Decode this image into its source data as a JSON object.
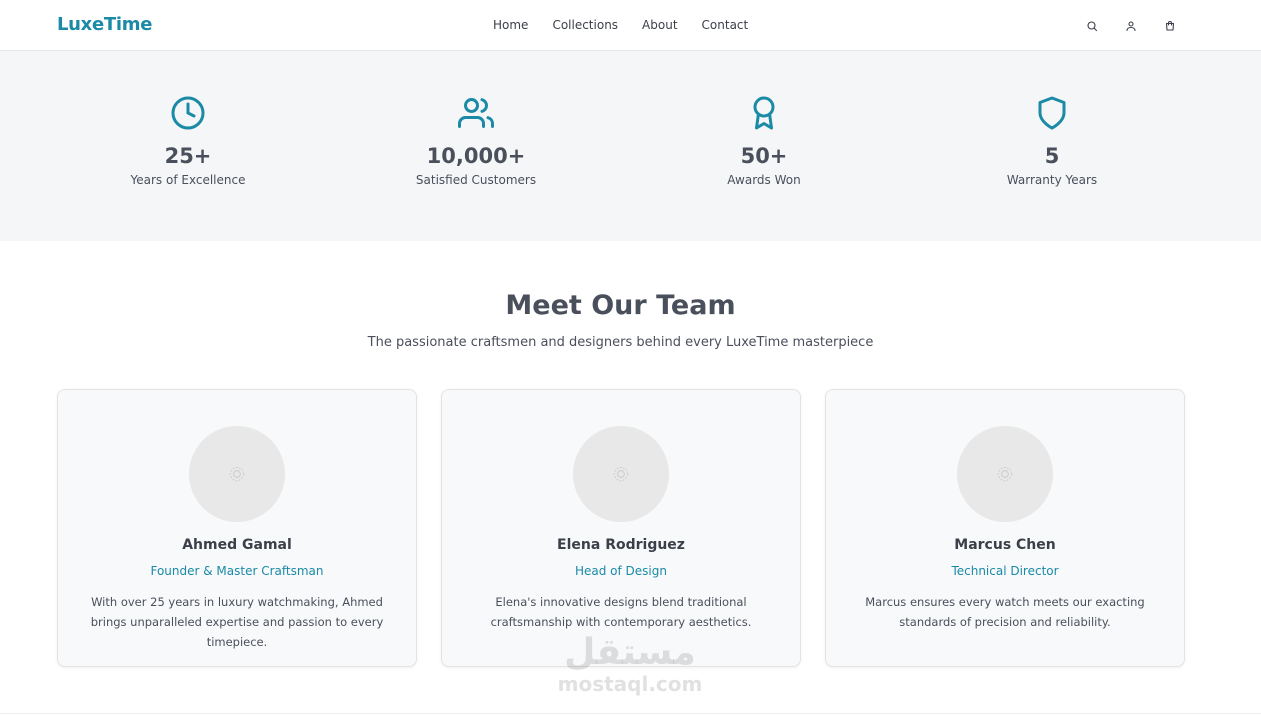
{
  "brand": {
    "name": "LuxeTime",
    "accent_color": "#1a8aa6"
  },
  "nav": {
    "items": [
      {
        "label": "Home"
      },
      {
        "label": "Collections"
      },
      {
        "label": "About"
      },
      {
        "label": "Contact"
      }
    ],
    "icons": [
      "search-icon",
      "user-icon",
      "cart-icon"
    ]
  },
  "stats": [
    {
      "icon": "clock-icon",
      "value": "25+",
      "label": "Years of Excellence"
    },
    {
      "icon": "users-icon",
      "value": "10,000+",
      "label": "Satisfied Customers"
    },
    {
      "icon": "award-icon",
      "value": "50+",
      "label": "Awards Won"
    },
    {
      "icon": "shield-icon",
      "value": "5",
      "label": "Warranty Years"
    }
  ],
  "team": {
    "title": "Meet Our Team",
    "subtitle": "The passionate craftsmen and designers behind every LuxeTime masterpiece",
    "members": [
      {
        "name": "Ahmed Gamal",
        "role": "Founder & Master Craftsman",
        "bio": "With over 25 years in luxury watchmaking, Ahmed brings unparalleled expertise and passion to every timepiece."
      },
      {
        "name": "Elena Rodriguez",
        "role": "Head of Design",
        "bio": "Elena's innovative designs blend traditional craftsmanship with contemporary aesthetics."
      },
      {
        "name": "Marcus Chen",
        "role": "Technical Director",
        "bio": "Marcus ensures every watch meets our exacting standards of precision and reliability."
      }
    ]
  },
  "watermark": {
    "arabic": "مستقل",
    "latin": "mostaql.com"
  }
}
